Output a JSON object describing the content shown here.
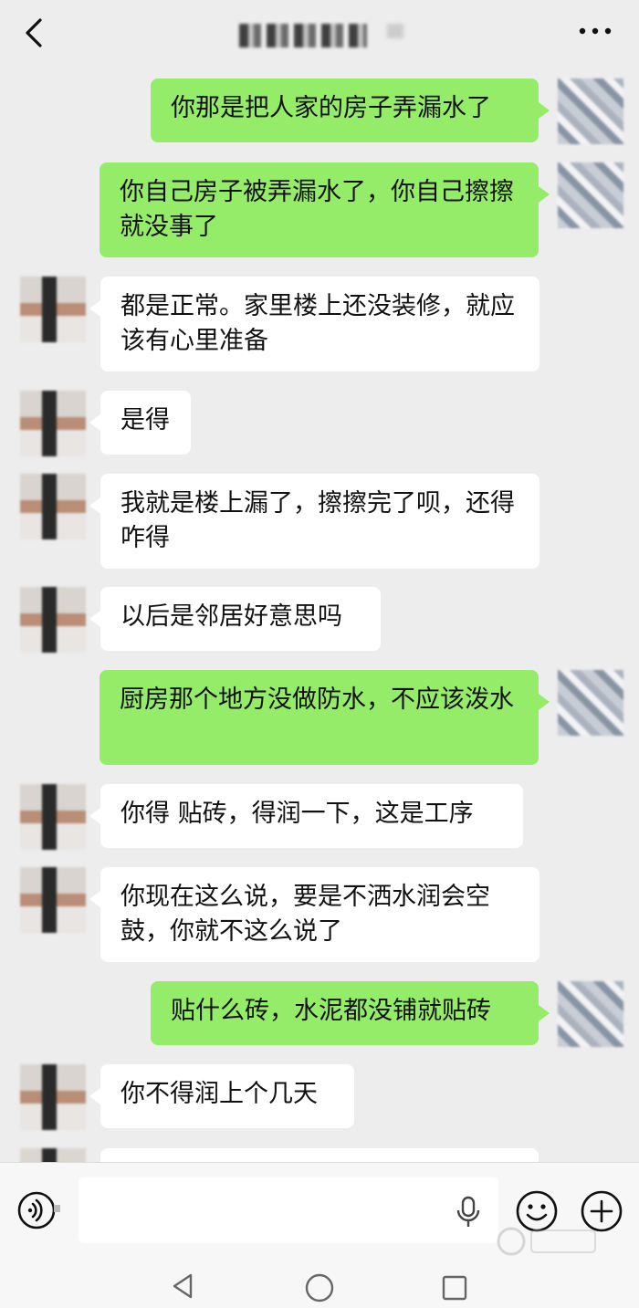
{
  "header": {
    "back_icon": "chevron-left-icon",
    "title": "",
    "more_icon": "more-dots-icon"
  },
  "messages": [
    {
      "side": "out",
      "text": "你那是把人家的房子弄漏水了"
    },
    {
      "side": "out",
      "text": "你自己房子被弄漏水了，你自己擦擦就没事了"
    },
    {
      "side": "in",
      "text": "都是正常。家里楼上还没装修，就应该有心里准备"
    },
    {
      "side": "in",
      "text": "是得"
    },
    {
      "side": "in",
      "text": "我就是楼上漏了，擦擦完了呗，还得咋得"
    },
    {
      "side": "in",
      "text": "以后是邻居好意思吗"
    },
    {
      "side": "out",
      "text": "厨房那个地方没做防水，不应该泼水"
    },
    {
      "side": "in",
      "text": "你得 贴砖，得润一下，这是工序"
    },
    {
      "side": "in",
      "text": "你现在这么说，要是不洒水润会空鼓，你就不这么说了"
    },
    {
      "side": "out",
      "text": "贴什么砖，水泥都没铺就贴砖"
    },
    {
      "side": "in",
      "text": "你不得润上个几天"
    }
  ],
  "input_bar": {
    "voice_icon": "voice-mode-icon",
    "mic_icon": "microphone-icon",
    "emoji_icon": "emoji-icon",
    "plus_icon": "plus-icon",
    "value": ""
  },
  "colors": {
    "background": "#ededed",
    "out_bubble": "#95ec69",
    "in_bubble": "#ffffff"
  }
}
